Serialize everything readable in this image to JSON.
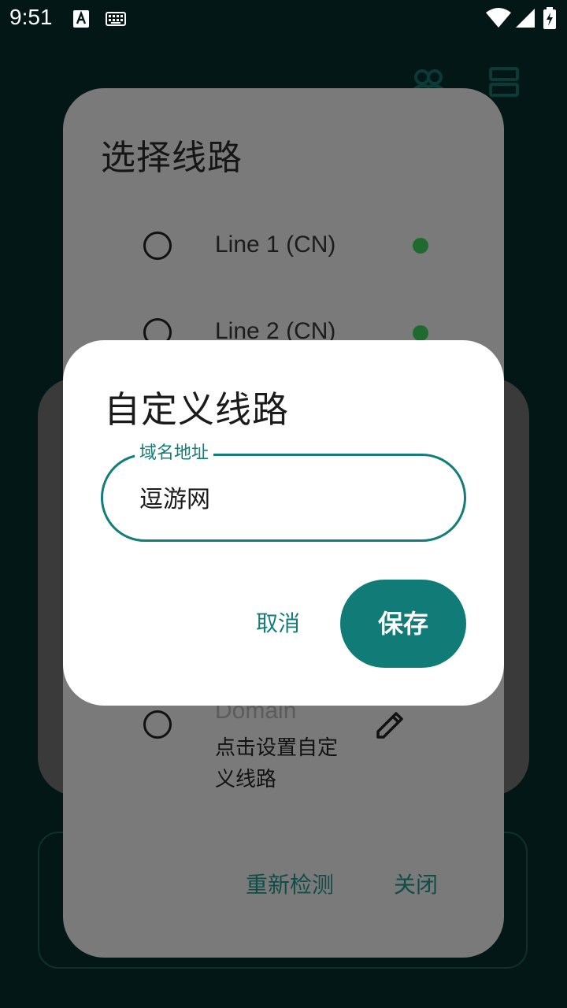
{
  "status_bar": {
    "time": "9:51"
  },
  "route_dialog": {
    "title": "选择线路",
    "lines": [
      {
        "label": "Line 1 (CN)",
        "status_color": "#1f6a2e"
      },
      {
        "label": "Line 2 (CN)",
        "status_color": "#1f6a2e"
      }
    ],
    "domain": {
      "label": "Domain",
      "hint": "点击设置自定义线路"
    },
    "recheck_label": "重新检测",
    "close_label": "关闭"
  },
  "custom_dialog": {
    "title": "自定义线路",
    "field_label": "域名地址",
    "field_value": "逗游网",
    "cancel_label": "取消",
    "save_label": "保存"
  },
  "colors": {
    "accent": "#117c77",
    "background": "#031816"
  },
  "icons": [
    "font-a-icon",
    "keyboard-icon",
    "wifi-icon",
    "signal-icon",
    "battery-icon",
    "people-icon",
    "server-icon",
    "edit-pencil-icon"
  ]
}
